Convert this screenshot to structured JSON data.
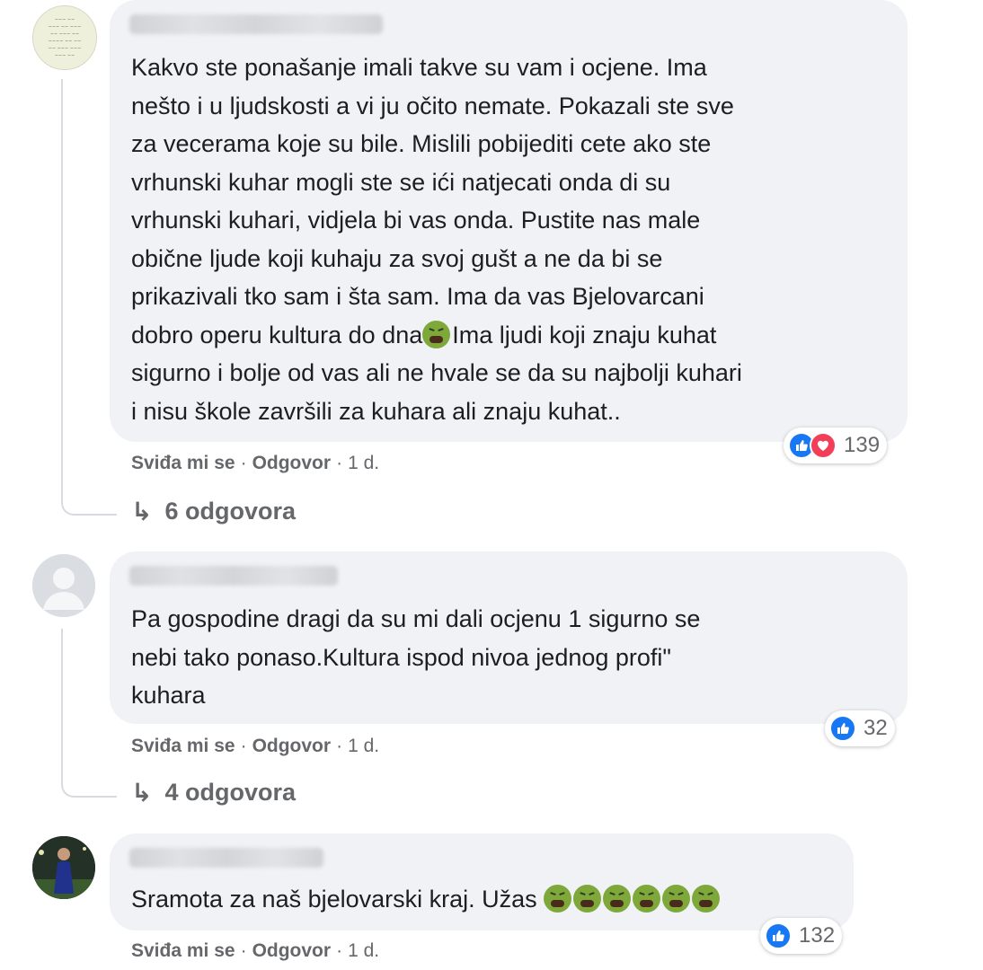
{
  "comments": [
    {
      "author": "",
      "avatar": "photo-avatar-note",
      "lines": [
        "Kakvo ste ponašanje imali takve su vam i ocjene. Ima",
        "nešto i u ljudskosti a vi ju očito nemate. Pokazali ste sve",
        "za vecerama koje su bile. Mislili pobijediti cete ako ste",
        "vrhunski kuhar mogli ste se ići natjecati onda di su",
        "vrhunski kuhari, vidjela bi vas onda. Pustite nas male",
        "obične ljude koji kuhaju za svoj gušt a ne da bi se",
        "prikazivali tko sam i šta sam. Ima da vas Bjelovarcani",
        "dobro operu kultura do dna",
        "Ima ljudi koji znaju kuhat",
        "sigurno i bolje od vas ali ne hvale se da su najbolji kuhari",
        "i nisu škole završili za kuhara ali znaju kuhat.."
      ],
      "reaction_icons": [
        "like-icon",
        "love-icon"
      ],
      "reaction_count": "139",
      "like_label": "Sviđa mi se",
      "reply_label": "Odgovor",
      "time": "1 d.",
      "replies_label": "6 odgovora"
    },
    {
      "author": "",
      "avatar": "default-avatar",
      "lines": [
        "Pa gospodine dragi da su mi dali ocjenu 1 sigurno se",
        "nebi tako ponaso.Kultura ispod nivoa jednog profi\"",
        "kuhara"
      ],
      "reaction_icons": [
        "like-icon"
      ],
      "reaction_count": "32",
      "like_label": "Sviđa mi se",
      "reply_label": "Odgovor",
      "time": "1 d.",
      "replies_label": "4 odgovora"
    },
    {
      "author": "",
      "avatar": "photo-avatar-person",
      "lines": [
        "Sramota za naš bjelovarski kraj. Užas"
      ],
      "emoji": "nauseated-face-icon",
      "emoji_count_in_text": 6,
      "reaction_icons": [
        "like-icon"
      ],
      "reaction_count": "132",
      "like_label": "Sviđa mi se",
      "reply_label": "Odgovor",
      "time": "1 d."
    }
  ],
  "separator": "·",
  "reply_arrow": "↳",
  "colors": {
    "bubble": "#f0f2f5",
    "text": "#1c1e21",
    "secondary": "#65676b",
    "like": "#1877f2",
    "love": "#f33e58",
    "emoji": "#7ea83a"
  }
}
